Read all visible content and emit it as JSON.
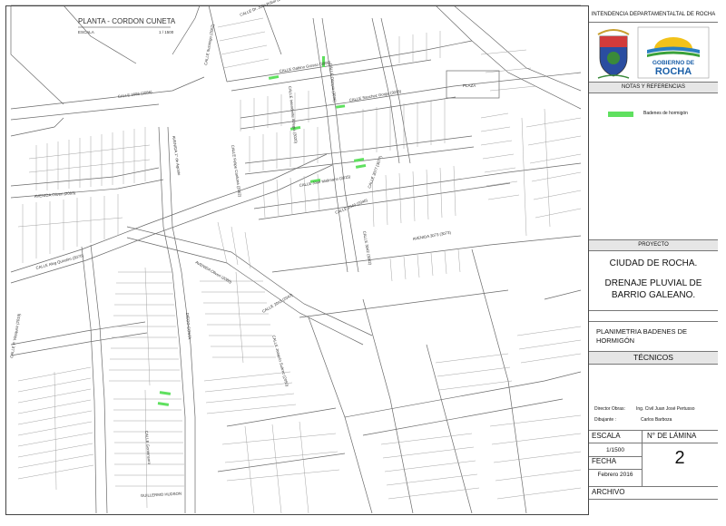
{
  "map": {
    "plan_title": "PLANTA - CORDON CUNETA",
    "scale_label": "ESCALA",
    "scale_value": "1 / 1500",
    "plaza_label": "PLAZA",
    "street_labels": [
      "CALLE 2086 (2086)",
      "CALLE Ituzaingo (2052)",
      "CALLE Dr. Julio Pribol (2033)",
      "AVENIDA Oliveri (2003)",
      "AVENIDA 1° de Agosto",
      "CALLE Felipe Cardona (2062)",
      "CALLE Gabino Grosso (3006)",
      "CALLE Sanchez Gorge (3015)",
      "CALLE Olimpia (3036)",
      "CALLE Intendente Arregui (3020)",
      "CALLE Aleg Quirulim (3070)",
      "CALLE José Mallmann (3015)",
      "CALLE 2040 (2040)",
      "AVENIDA 3073 (3073)",
      "CALLE 3077 (3077)",
      "CALLE 2043 (2043)",
      "AVENIDA Oliveri (2086)",
      "CALLE 3042 (3042)",
      "CALLE Joaquín Suárez (2050)",
      "CALLE P. Vásquez (2019)",
      "DIEGO COSTA",
      "CALLE Gomensoro",
      "GUILLERMO HUDSON"
    ]
  },
  "panel": {
    "authority": "INTENDENCIA DEPARTAMENTALTAL DE ROCHA",
    "logo_text_top": "GOBIERNO DE",
    "logo_text_bottom": "ROCHA",
    "notes_header": "NOTAS Y REFERENCIAS",
    "legend_label": "Badenes de hormigón",
    "project_header": "PROYECTO",
    "project_city": "CIUDAD DE ROCHA.",
    "project_line1": "DRENAJE PLUVIAL DE",
    "project_line2": "BARRIO GALEANO.",
    "sheet_title_line1": "PLANIMETRIA BADENES DE",
    "sheet_title_line2": "HORMIGÓN",
    "technicians_header": "TÉCNICOS",
    "director_role": "Director Obras:",
    "director_name": "Ing. Civil Juan José Pertusso",
    "drafter_role": "Dibujante :",
    "drafter_name": "Carlos Barboza",
    "scale_header": "ESCALA",
    "scale_value": "1/1500",
    "sheet_no_header": "N° DE LÁMINA",
    "sheet_no": "2",
    "date_header": "FECHA",
    "date_value": "Febrero 2016",
    "archive_header": "ARCHIVO"
  },
  "colors": {
    "badenes": "#5fe05f",
    "streets": "#555555",
    "blocks": "#8a8a8a"
  }
}
